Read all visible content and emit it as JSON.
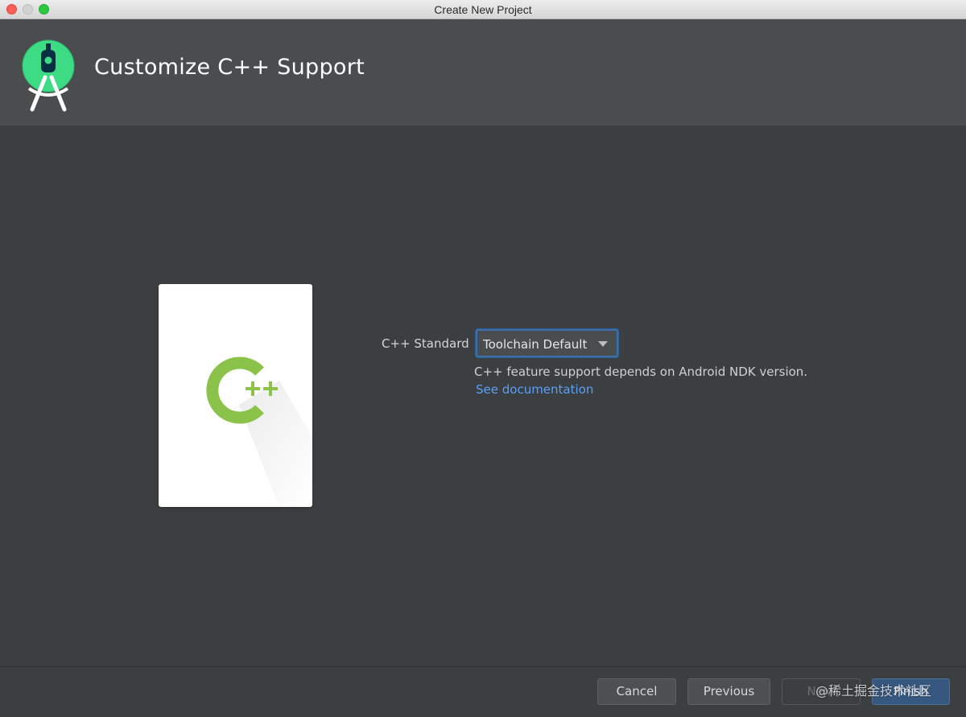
{
  "window": {
    "title": "Create New Project"
  },
  "header": {
    "title": "Customize C++ Support",
    "logo_icon": "android-studio-logo-icon"
  },
  "illustration": {
    "icon": "cpp-logo-icon",
    "glyph_c": "C",
    "glyph_pp": "++",
    "accent_color": "#8bc34a"
  },
  "form": {
    "standard_label": "C++ Standard",
    "standard_value": "Toolchain Default",
    "hint": "C++ feature support depends on Android NDK version.",
    "doc_link": "See documentation"
  },
  "footer": {
    "cancel_label": "Cancel",
    "previous_label": "Previous",
    "next_label": "Next",
    "finish_label": "Finish"
  },
  "watermark": "@稀土掘金技术社区",
  "colors": {
    "dialog_bg": "#3c3f41",
    "header_bg": "#4b4c4e",
    "link": "#5d9ff5",
    "primary_button": "#365880"
  }
}
